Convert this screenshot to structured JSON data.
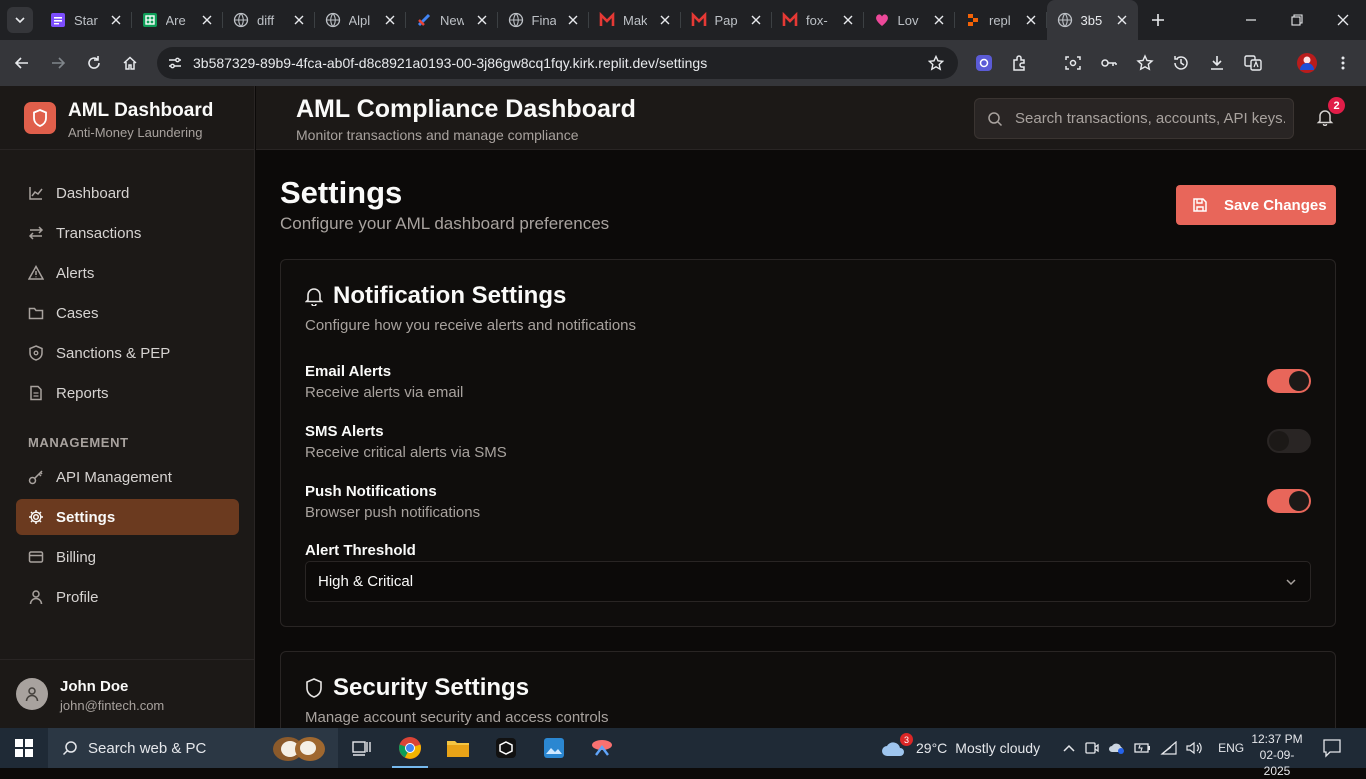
{
  "browser": {
    "tabs": [
      {
        "title": "Star",
        "icon": "forms-icon"
      },
      {
        "title": "Are",
        "icon": "sheets-icon"
      },
      {
        "title": "diff",
        "icon": "globe-icon"
      },
      {
        "title": "Alpl",
        "icon": "globe-icon"
      },
      {
        "title": "New",
        "icon": "news-icon"
      },
      {
        "title": "Fina",
        "icon": "globe-icon"
      },
      {
        "title": "Mak",
        "icon": "m-logo-icon"
      },
      {
        "title": "Pap",
        "icon": "m-logo-icon"
      },
      {
        "title": "fox-",
        "icon": "m-logo-icon"
      },
      {
        "title": "Lov",
        "icon": "heart-logo-icon"
      },
      {
        "title": "repl",
        "icon": "replit-icon"
      },
      {
        "title": "3b5",
        "icon": "globe-icon"
      }
    ],
    "url": "3b587329-89b9-4fca-ab0f-d8c8921a0193-00-3j86gw8cq1fqy.kirk.replit.dev/settings"
  },
  "sidebar": {
    "brand_title": "AML Dashboard",
    "brand_subtitle": "Anti-Money Laundering",
    "items": [
      {
        "label": "Dashboard",
        "icon": "chart-line-icon"
      },
      {
        "label": "Transactions",
        "icon": "arrows-exchange-icon"
      },
      {
        "label": "Alerts",
        "icon": "warning-triangle-icon"
      },
      {
        "label": "Cases",
        "icon": "folder-icon"
      },
      {
        "label": "Sanctions & PEP",
        "icon": "shield-icon"
      },
      {
        "label": "Reports",
        "icon": "document-icon"
      }
    ],
    "section_label": "MANAGEMENT",
    "management_items": [
      {
        "label": "API Management",
        "icon": "key-icon"
      },
      {
        "label": "Settings",
        "icon": "gear-icon",
        "active": true
      },
      {
        "label": "Billing",
        "icon": "credit-card-icon"
      },
      {
        "label": "Profile",
        "icon": "user-icon"
      }
    ],
    "user": {
      "name": "John Doe",
      "email": "john@fintech.com"
    }
  },
  "header": {
    "title": "AML Compliance Dashboard",
    "subtitle": "Monitor transactions and manage compliance",
    "search_placeholder": "Search transactions, accounts, API keys...",
    "notification_count": "2"
  },
  "page": {
    "title": "Settings",
    "subtitle": "Configure your AML dashboard preferences",
    "save_label": "Save Changes"
  },
  "notification_card": {
    "title": "Notification Settings",
    "subtitle": "Configure how you receive alerts and notifications",
    "settings": [
      {
        "label": "Email Alerts",
        "desc": "Receive alerts via email",
        "enabled": true
      },
      {
        "label": "SMS Alerts",
        "desc": "Receive critical alerts via SMS",
        "enabled": false
      },
      {
        "label": "Push Notifications",
        "desc": "Browser push notifications",
        "enabled": true
      }
    ],
    "threshold_label": "Alert Threshold",
    "threshold_value": "High & Critical"
  },
  "security_card": {
    "title": "Security Settings",
    "subtitle": "Manage account security and access controls"
  },
  "taskbar": {
    "search_label": "Search web & PC",
    "weather_badge": "3",
    "temperature": "29°C",
    "weather": "Mostly cloudy",
    "language": "ENG",
    "time": "12:37 PM",
    "date": "02-09-2025"
  },
  "colors": {
    "accent": "#e8665a",
    "active_nav": "#6b3a1f",
    "sidebar_bg": "#1c1917",
    "page_bg": "#0c0a09"
  }
}
